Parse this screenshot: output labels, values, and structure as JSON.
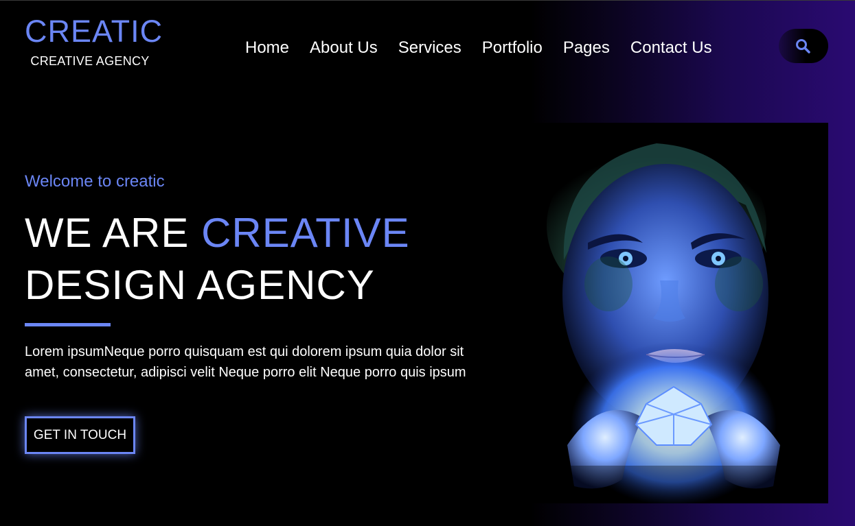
{
  "header": {
    "logo_title": "CREATIC",
    "logo_subtitle": "CREATIVE AGENCY"
  },
  "nav": {
    "items": [
      "Home",
      "About Us",
      "Services",
      "Portfolio",
      "Pages",
      "Contact Us"
    ]
  },
  "search": {
    "icon": "search-icon"
  },
  "hero": {
    "welcome": "Welcome to creatic",
    "headline_part1": "WE ARE ",
    "headline_accent": "CREATIVE",
    "headline_line2": "DESIGN AGENCY",
    "paragraph": "Lorem ipsumNeque porro quisquam est qui dolorem ipsum quia dolor sit amet, consectetur, adipisci velit Neque porro elit Neque porro quis ipsum",
    "cta_label": "GET IN TOUCH",
    "image": "woman-holding-glowing-crystal"
  },
  "colors": {
    "accent": "#6b86f5",
    "background": "#000000",
    "gradient_end": "#2a0a72",
    "text": "#ffffff"
  }
}
